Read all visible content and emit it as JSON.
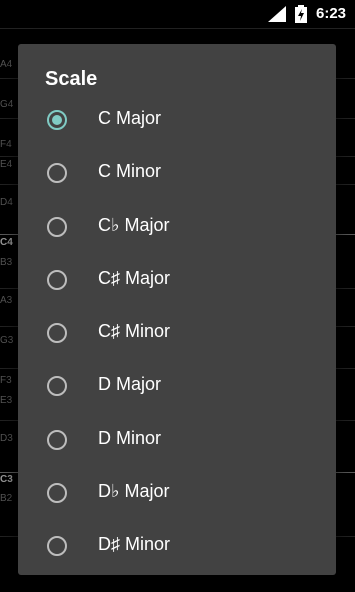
{
  "status_bar": {
    "time": "6:23",
    "icons": [
      "signal-icon",
      "battery-charging-icon"
    ]
  },
  "background": {
    "note_labels": [
      "A4",
      "G4",
      "F4",
      "E4",
      "D4",
      "C4",
      "B3",
      "A3",
      "G3",
      "F3",
      "E3",
      "D3",
      "C3",
      "B2"
    ]
  },
  "dialog": {
    "title": "Scale",
    "selected_index": 0,
    "accent_color": "#80cbc4",
    "items": [
      {
        "label": "C Major"
      },
      {
        "label": "C Minor"
      },
      {
        "label": "C♭ Major"
      },
      {
        "label": "C♯ Major"
      },
      {
        "label": "C♯ Minor"
      },
      {
        "label": "D Major"
      },
      {
        "label": "D Minor"
      },
      {
        "label": "D♭ Major"
      },
      {
        "label": "D♯ Minor"
      }
    ]
  }
}
